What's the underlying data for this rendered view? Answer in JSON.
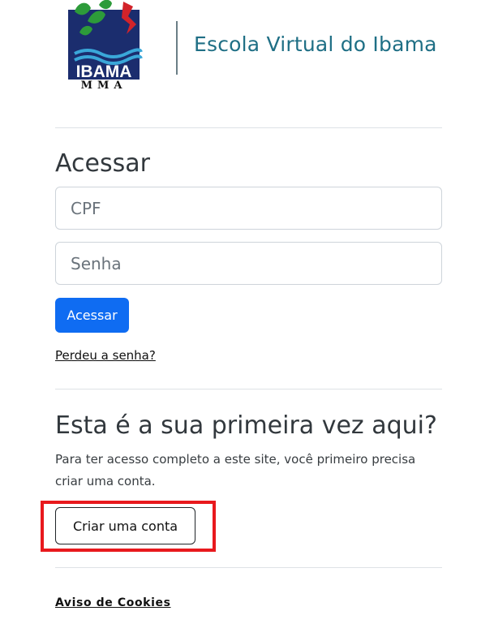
{
  "header": {
    "logo_icon": "ibama-logo-icon",
    "logo_text": "IBAMA",
    "logo_subtext": "MMA",
    "site_name": "Escola Virtual do Ibama",
    "colors": {
      "logo_blue": "#1b2d6e",
      "logo_green": "#2d9b3a",
      "logo_red": "#d2232a",
      "logo_cyan": "#3aa7d9",
      "site_name": "#1f6f85"
    }
  },
  "login": {
    "title": "Acessar",
    "cpf_placeholder": "CPF",
    "cpf_value": "",
    "password_placeholder": "Senha",
    "password_value": "",
    "submit_label": "Acessar",
    "forgot_password_link": "Perdeu a senha?",
    "primary_color": "#0f6cf2"
  },
  "signup": {
    "title": "Esta é a sua primeira vez aqui?",
    "description": "Para ter acesso completo a este site, você primeiro precisa criar uma conta.",
    "create_account_label": "Criar uma conta",
    "highlight_color": "#e8191d"
  },
  "footer": {
    "cookie_link": "Aviso de Cookies"
  }
}
